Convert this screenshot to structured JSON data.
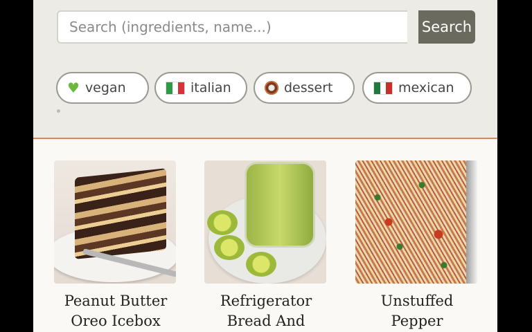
{
  "search": {
    "placeholder": "Search (ingredients, name...)",
    "button_label": "Search"
  },
  "tags": [
    {
      "icon": "green-heart-icon",
      "label": "vegan"
    },
    {
      "icon": "italy-flag-icon",
      "label": "italian"
    },
    {
      "icon": "donut-icon",
      "label": "dessert"
    },
    {
      "icon": "mexico-flag-icon",
      "label": "mexican"
    }
  ],
  "recipes": [
    {
      "title_line1": "Peanut Butter",
      "title_line2": "Oreo Icebox",
      "image": "peanut-butter-oreo-icebox-cake-photo"
    },
    {
      "title_line1": "Refrigerator",
      "title_line2": "Bread And",
      "image": "refrigerator-pickles-jar-photo"
    },
    {
      "title_line1": "Unstuffed",
      "title_line2": "Pepper",
      "image": "unstuffed-pepper-casserole-photo"
    }
  ],
  "colors": {
    "header_bg": "#ecebe6",
    "accent_line": "#d9875a",
    "search_button": "#6b6a5f"
  }
}
